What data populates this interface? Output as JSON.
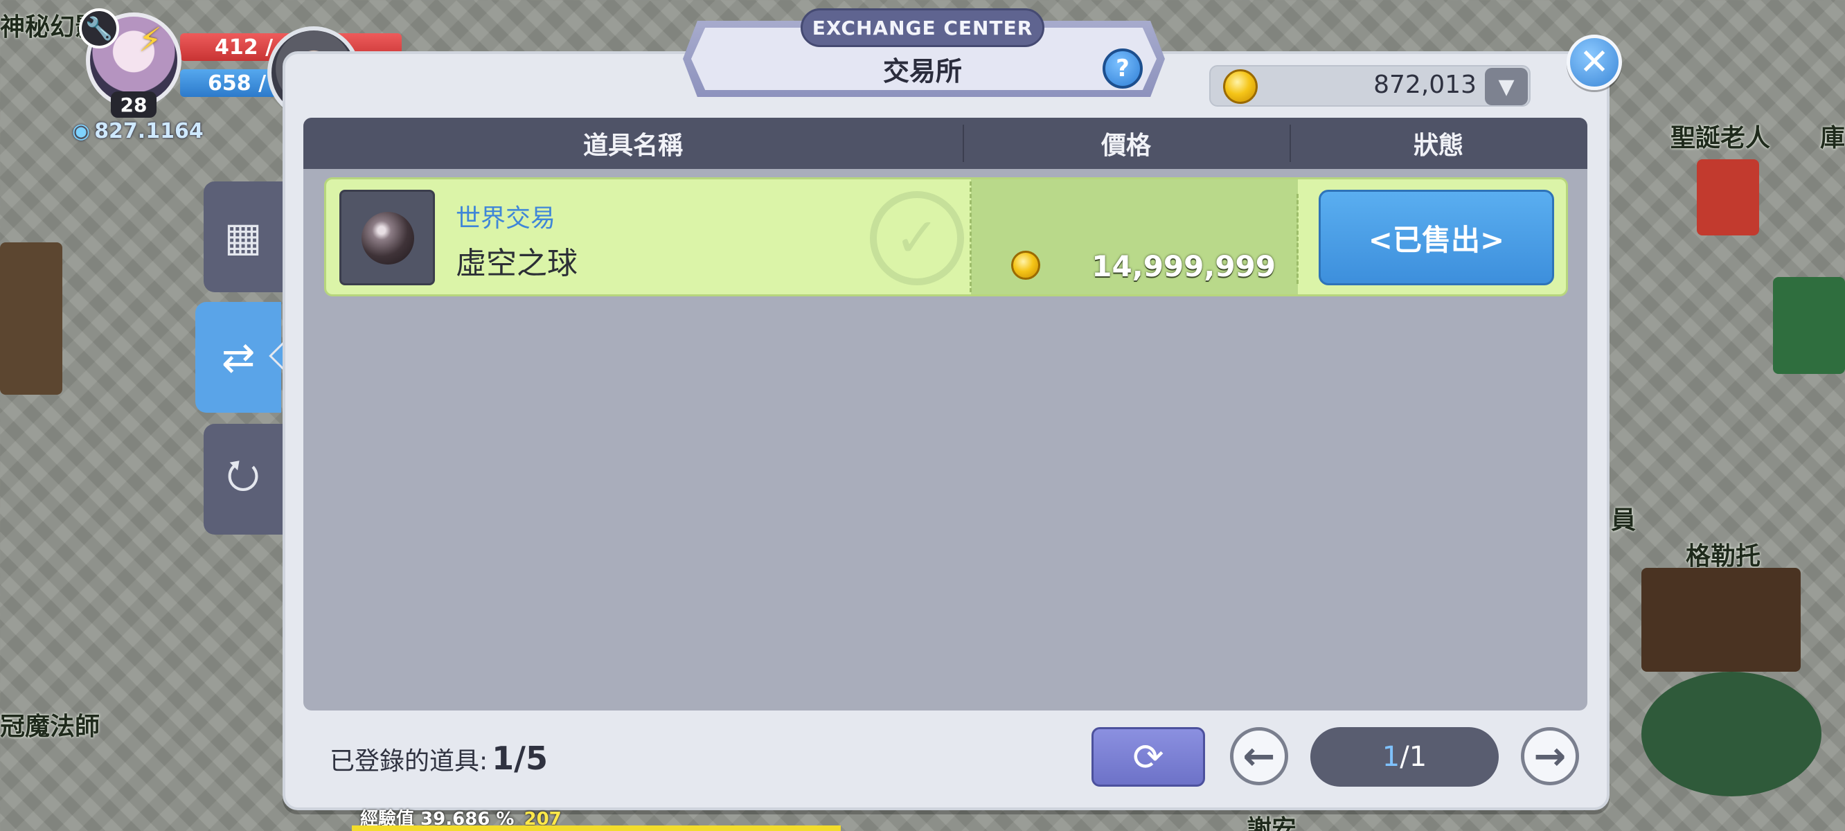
{
  "hud": {
    "level": "28",
    "hp": "412 /",
    "mp": "658 /",
    "coords": "827.1164"
  },
  "world_labels": {
    "top_left": "神秘幻影",
    "santa": "聖誕老人",
    "right_edge": "庫",
    "clerk": "員",
    "npc": "格勒托",
    "mage": "冠魔法師",
    "bottom": "謝安"
  },
  "exp": {
    "label": "經驗值 39.686 %",
    "level": "207",
    "percent": 39.686
  },
  "panel": {
    "subtitle_en": "EXCHANGE CENTER",
    "title": "交易所",
    "help": "?",
    "close": "✕"
  },
  "currency": {
    "gold": "872,013",
    "dropdown": "▼"
  },
  "side_tabs": [
    {
      "name": "tab-materials",
      "icon": "ingots-icon",
      "active": false
    },
    {
      "name": "tab-trade",
      "icon": "item-exchange-icon",
      "active": true
    },
    {
      "name": "tab-collect",
      "icon": "money-bag-icon",
      "active": false
    }
  ],
  "table": {
    "headers": {
      "name": "道具名稱",
      "price": "價格",
      "status": "狀態"
    },
    "rows": [
      {
        "category": "世界交易",
        "name": "虛空之球",
        "icon": "void-orb-icon",
        "price": "14,999,999",
        "status": "<已售出>"
      }
    ]
  },
  "footer": {
    "registered_label": "已登錄的道具:",
    "registered_count": "1/5",
    "refresh": "⟳",
    "prev": "←",
    "next": "→",
    "page_current": "1",
    "page_total": "/1"
  },
  "colors": {
    "panel_bg": "#e5e8ef",
    "header_bg": "#4f5367",
    "row_bg": "#dbf4a8",
    "status_blue": "#4a9be6",
    "accent_purple": "#7a7fd6"
  }
}
